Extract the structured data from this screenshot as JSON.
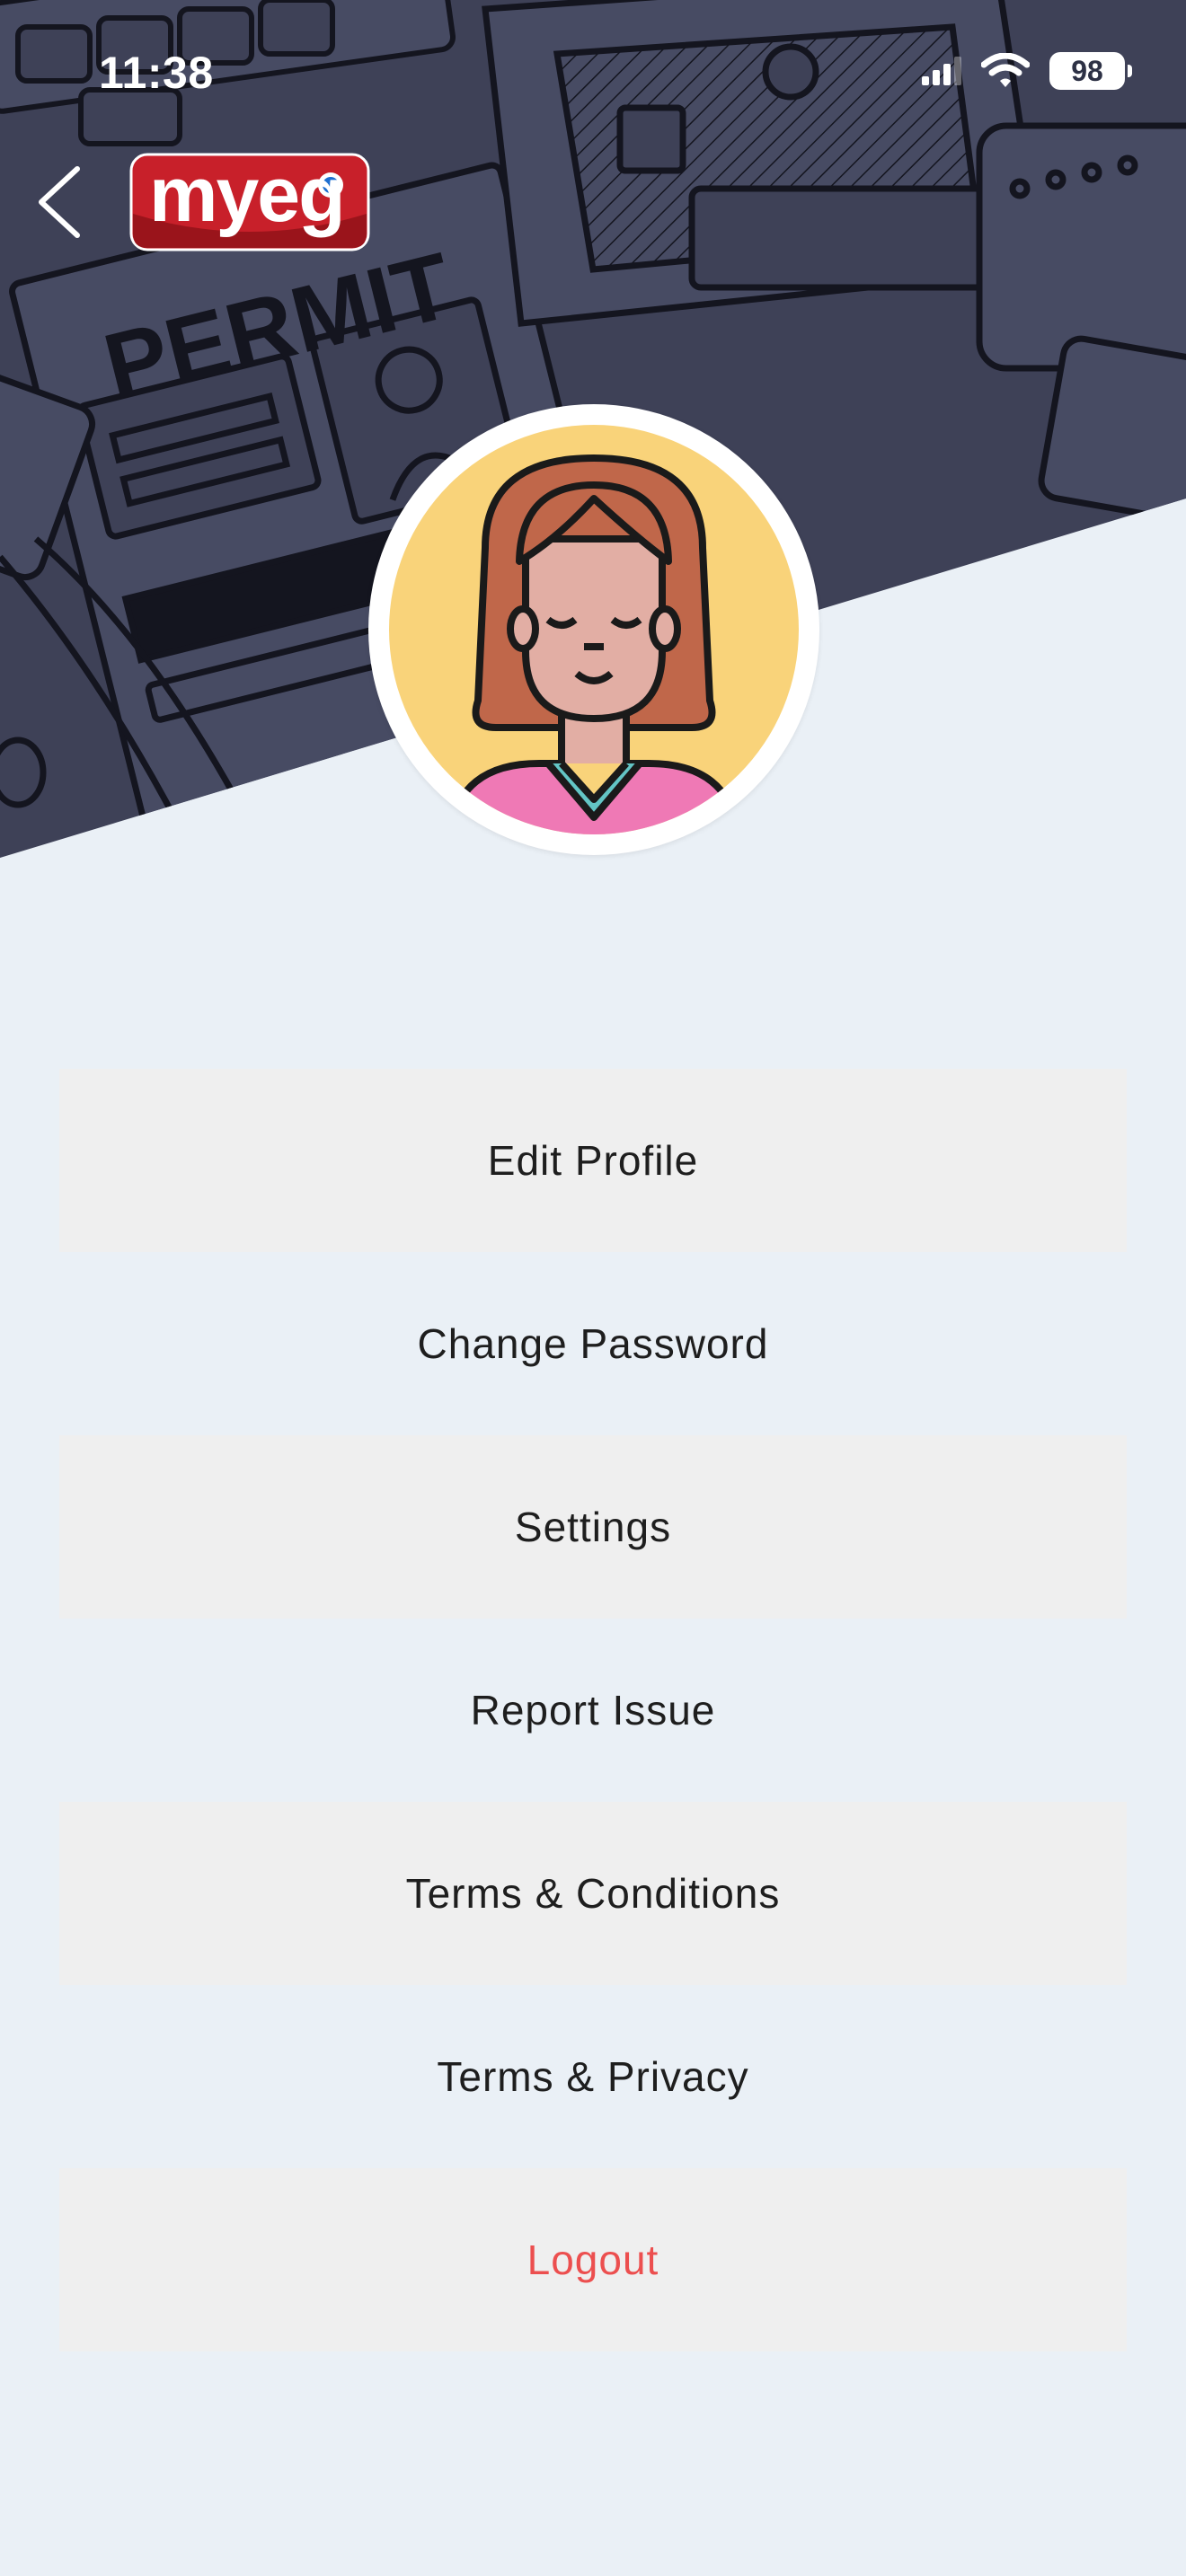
{
  "status_bar": {
    "time": "11:38",
    "battery": "98"
  },
  "header": {
    "logo_text": "myeg",
    "background_sign_text": "PERMIT",
    "colors": {
      "background": "#3e4157",
      "line_art": "#14151f",
      "logo_red": "#c8202a"
    }
  },
  "menu": {
    "items": [
      {
        "label": "Edit Profile"
      },
      {
        "label": "Change Password"
      },
      {
        "label": "Settings"
      },
      {
        "label": "Report Issue"
      },
      {
        "label": "Terms & Conditions"
      },
      {
        "label": "Terms & Privacy"
      },
      {
        "label": "Logout"
      }
    ],
    "colors": {
      "text": "#1e1e1e",
      "logout": "#ec4f4f",
      "shaded_row": "#efefef"
    }
  },
  "icons": {
    "back": "chevron-left-icon",
    "signal": "cellular-signal-icon",
    "wifi": "wifi-icon",
    "battery": "battery-icon",
    "avatar": "user-avatar-illustration"
  }
}
